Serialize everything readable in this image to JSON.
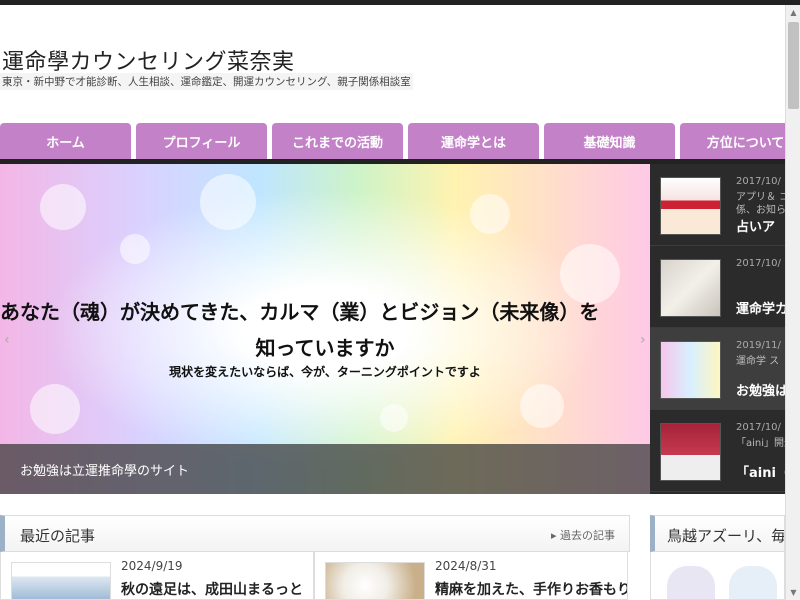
{
  "site": {
    "title": "運命學カウンセリング菜奈実",
    "description": "東京・新中野で才能診断、人生相談、運命鑑定、開運カウンセリング、親子関係相談室"
  },
  "nav": {
    "items": [
      "ホーム",
      "プロフィール",
      "これまでの活動",
      "運命学とは",
      "基礎知識",
      "方位について"
    ]
  },
  "hero": {
    "line1": "あなた（魂）が決めてきた、カルマ（業）とビジョン（未来像）を",
    "line2": "知っていますか",
    "line3": "現状を変えたいならば、今が、ターニングポイントですよ",
    "caption": "お勉強は立運推命學のサイト",
    "prev": "‹",
    "next": "›"
  },
  "side": {
    "items": [
      {
        "date": "2017/10/",
        "sub": "アプリ＆ コ\n係、お知ら",
        "title": "占いア"
      },
      {
        "date": "2017/10/",
        "sub": "",
        "title": "運命学カ"
      },
      {
        "date": "2019/11/",
        "sub": "運命学 ス",
        "title": "お勉強は"
      },
      {
        "date": "2017/10/",
        "sub": "「aini」開運",
        "title": "「aini（旧"
      }
    ]
  },
  "recent": {
    "heading": "最近の記事",
    "more": "過去の記事",
    "cards": [
      {
        "date": "2024/9/19",
        "title": "秋の遠足は、成田山まるっと"
      },
      {
        "date": "2024/8/31",
        "title": "精麻を加えた、手作りお香もり"
      }
    ]
  },
  "widget": {
    "heading": "鳥越アズーリ、毎週"
  },
  "colors": {
    "nav": "#c382c8",
    "dark": "#2b2b2b",
    "accent_border": "#9cb0c6"
  }
}
